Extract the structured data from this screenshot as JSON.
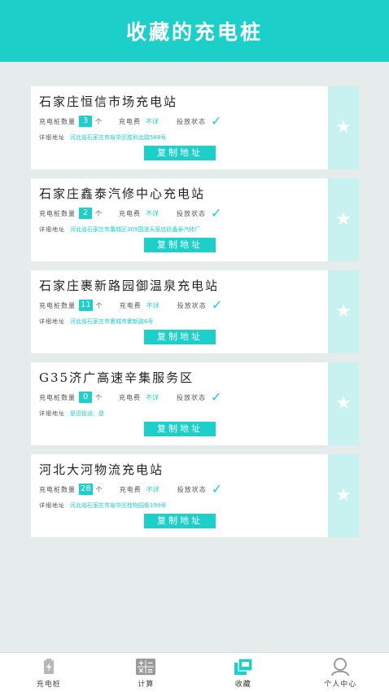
{
  "header": {
    "title": "收藏的充电桩"
  },
  "labels": {
    "pile_count": "充电桩数量",
    "unit": "个",
    "fee": "充电费",
    "status": "投放状态",
    "address": "详细地址",
    "copy_button": "复制地址"
  },
  "stations": [
    {
      "name": "石家庄恒信市场充电站",
      "count": "3",
      "fee": "不详",
      "address": "河北省石家庄市裕华区胜利北路588号"
    },
    {
      "name": "石家庄鑫泰汽修中心充电站",
      "count": "2",
      "fee": "不详",
      "address": "河北省石家庄市藁城区309国道天家店段鑫泰汽修厂"
    },
    {
      "name": "石家庄裹新路园御温泉充电站",
      "count": "11",
      "fee": "不详",
      "address": "河北省石家庄市裹城市裹新路6号"
    },
    {
      "name": "G35济广高速辛集服务区",
      "count": "0",
      "fee": "不详",
      "address": "是否投运：是"
    },
    {
      "name": "河北大河物流充电站",
      "count": "28",
      "fee": "不详",
      "address": "河北省石家庄市裕华区桂物园街199号"
    }
  ],
  "bottom_nav": [
    {
      "label": "充电桩",
      "icon": "battery-icon",
      "active": false
    },
    {
      "label": "计算",
      "icon": "calculator-icon",
      "active": false
    },
    {
      "label": "收藏",
      "icon": "favorites-icon",
      "active": true
    },
    {
      "label": "个人中心",
      "icon": "user-icon",
      "active": false
    }
  ],
  "colors": {
    "accent": "#1ccfc9",
    "favorite_panel": "#c8f2ef",
    "background": "#e6eceb"
  }
}
